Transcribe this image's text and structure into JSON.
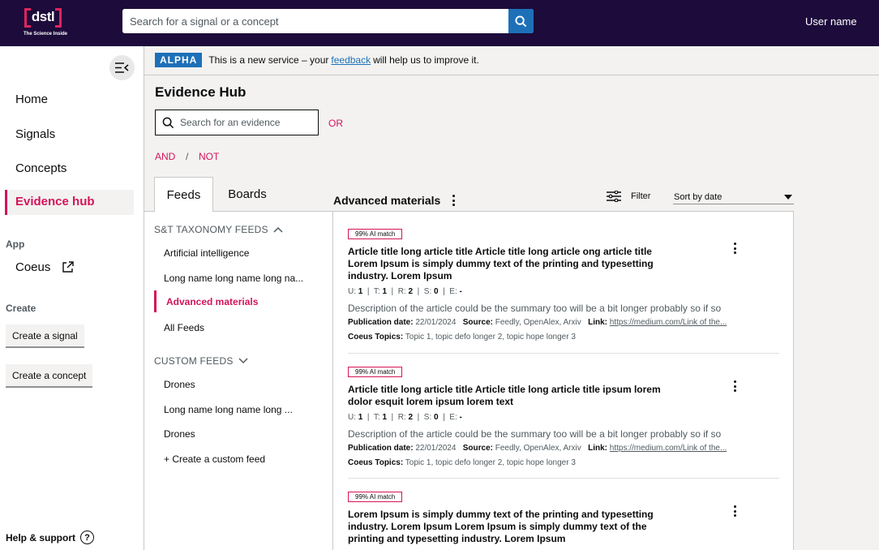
{
  "header": {
    "logo_text": "dstl",
    "logo_tagline": "The Science Inside",
    "search_placeholder": "Search for a signal or a concept",
    "user_name": "User name"
  },
  "sidebar": {
    "nav": [
      "Home",
      "Signals",
      "Concepts",
      "Evidence hub"
    ],
    "app_heading": "App",
    "app_link": "Coeus",
    "create_heading": "Create",
    "create_signal": "Create a signal",
    "create_concept": "Create a concept",
    "help": "Help & support"
  },
  "banner": {
    "tag": "ALPHA",
    "text_before": "This is a new service – your",
    "link": "feedback",
    "text_after": "will help us to improve it."
  },
  "main": {
    "title": "Evidence Hub",
    "search_placeholder": "Search for an evidence",
    "or_label": "OR",
    "and_label": "AND",
    "sep": "/",
    "not_label": "NOT",
    "tabs": [
      "Feeds",
      "Boards"
    ],
    "feed_title": "Advanced materials",
    "filter_label": "Filter",
    "sort_value": "Sort by date"
  },
  "feeds": {
    "taxonomy_heading": "S&T TAXONOMY FEEDS",
    "taxonomy_items": [
      "Artificial intelligence",
      "Long name long name long na...",
      "Advanced materials",
      "All Feeds"
    ],
    "custom_heading": "CUSTOM FEEDS",
    "custom_items": [
      "Drones",
      "Long name long name long ...",
      "Drones"
    ],
    "create_custom": "+ Create a custom feed"
  },
  "results": [
    {
      "match": "99% AI match",
      "title": "Article title long article title Article title long article ong article title Lorem Ipsum is simply dummy text of the printing and typesetting industry. Lorem Ipsum",
      "stats": {
        "U": "1",
        "T": "1",
        "R": "2",
        "S": "0",
        "E": "-"
      },
      "description": "Description of the article could  be the summary too will be a  bit longer probably so if so",
      "pub_date_label": "Publication date:",
      "pub_date": "22/01/2024",
      "source_label": "Source:",
      "source": "Feedly, OpenAlex, Arxiv",
      "link_label": "Link:",
      "link": "https://medium.com/Link of the...",
      "topics_label": "Coeus Topics:",
      "topics": "Topic 1, topic defo longer 2, topic hope longer 3"
    },
    {
      "match": "99% AI match",
      "title": "Article title long article title Article title long article title ipsum lorem dolor esquit lorem ipsum lorem text",
      "stats": {
        "U": "1",
        "T": "1",
        "R": "2",
        "S": "0",
        "E": "-"
      },
      "description": "Description of the article could  be the summary too will be a  bit longer probably so if so",
      "pub_date_label": "Publication date:",
      "pub_date": "22/01/2024",
      "source_label": "Source:",
      "source": "Feedly, OpenAlex, Arxiv",
      "link_label": "Link:",
      "link": "https://medium.com/Link of the...",
      "topics_label": "Coeus Topics:",
      "topics": "Topic 1, topic defo longer 2, topic hope longer 3"
    },
    {
      "match": "99% AI match",
      "title": "Lorem Ipsum is simply dummy text of the printing and typesetting industry. Lorem Ipsum Lorem Ipsum is simply dummy text of the printing and typesetting industry. Lorem Ipsum"
    }
  ],
  "colors": {
    "header_bg": "#1c0b3b",
    "accent": "#d4145a",
    "link_blue": "#1d70b8"
  }
}
